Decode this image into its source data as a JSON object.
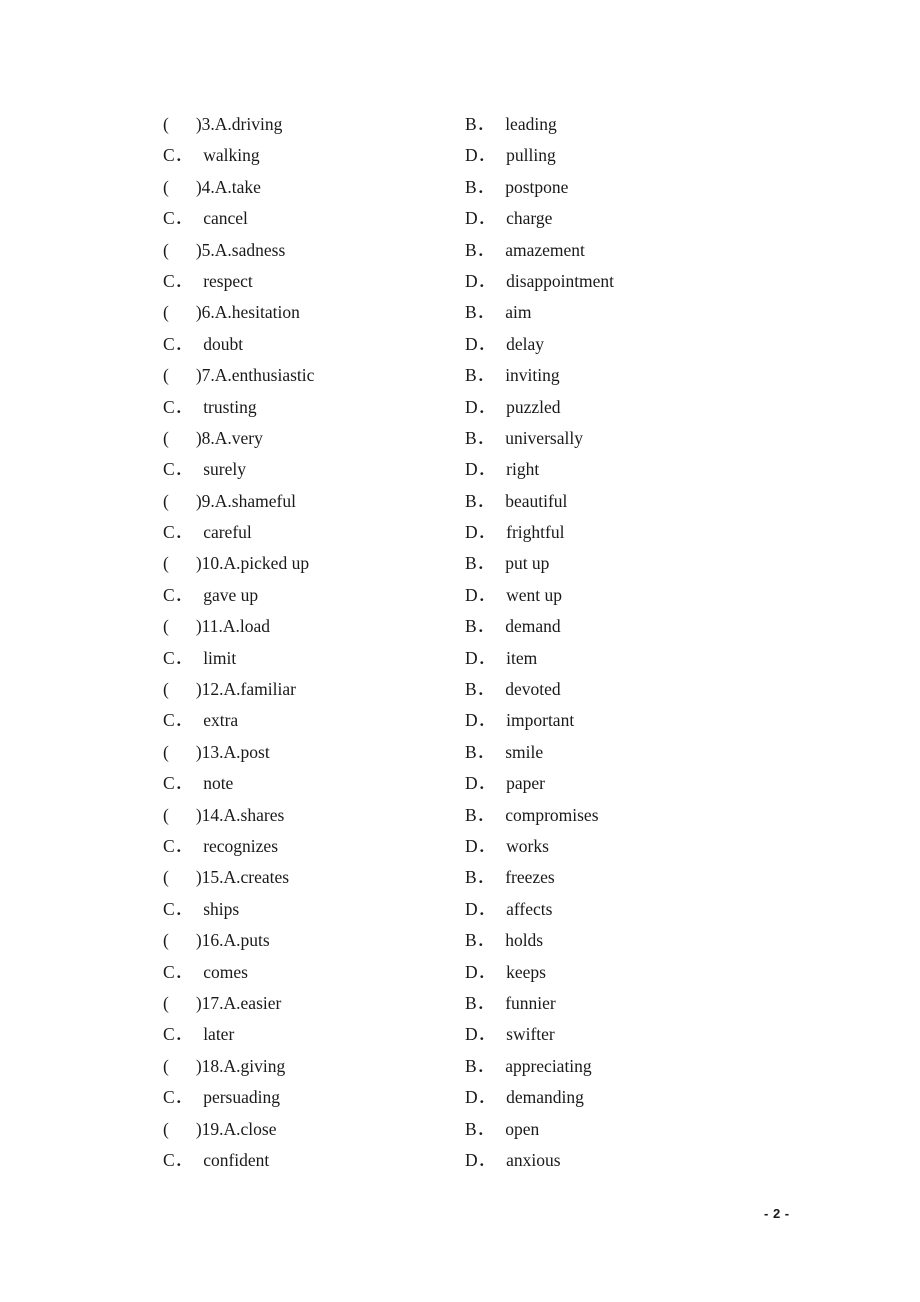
{
  "page": {
    "footer_label": "- 2 -",
    "page_number": "2",
    "background_color": "#ffffff",
    "text_color": "#1a1a1a"
  },
  "labels": {
    "open_paren": "(",
    "close_paren": ")",
    "label_b": "B．",
    "label_c": "C．",
    "label_d": "D．"
  },
  "questions": [
    {
      "number": "3",
      "stem": ")3.A.driving",
      "a": "driving",
      "b": "leading",
      "c": "walking",
      "d": "pulling"
    },
    {
      "number": "4",
      "stem": ")4.A.take",
      "a": "take",
      "b": "postpone",
      "c": "cancel",
      "d": "charge"
    },
    {
      "number": "5",
      "stem": ")5.A.sadness",
      "a": "sadness",
      "b": "amazement",
      "c": "respect",
      "d": "disappointment"
    },
    {
      "number": "6",
      "stem": ")6.A.hesitation",
      "a": "hesitation",
      "b": "aim",
      "c": "doubt",
      "d": "delay"
    },
    {
      "number": "7",
      "stem": ")7.A.enthusiastic",
      "a": "enthusiastic",
      "b": "inviting",
      "c": "trusting",
      "d": "puzzled"
    },
    {
      "number": "8",
      "stem": ")8.A.very",
      "a": "very",
      "b": "universally",
      "c": "surely",
      "d": "right"
    },
    {
      "number": "9",
      "stem": ")9.A.shameful",
      "a": "shameful",
      "b": "beautiful",
      "c": "careful",
      "d": "frightful"
    },
    {
      "number": "10",
      "stem": ")10.A.picked up",
      "a": "picked up",
      "b": "put up",
      "c": "gave up",
      "d": "went up"
    },
    {
      "number": "11",
      "stem": ")11.A.load",
      "a": "load",
      "b": "demand",
      "c": "limit",
      "d": "item"
    },
    {
      "number": "12",
      "stem": ")12.A.familiar",
      "a": "familiar",
      "b": "devoted",
      "c": "extra",
      "d": "important"
    },
    {
      "number": "13",
      "stem": ")13.A.post",
      "a": "post",
      "b": "smile",
      "c": "note",
      "d": "paper"
    },
    {
      "number": "14",
      "stem": ")14.A.shares",
      "a": "shares",
      "b": "compromises",
      "c": "recognizes",
      "d": "works"
    },
    {
      "number": "15",
      "stem": ")15.A.creates",
      "a": "creates",
      "b": "freezes",
      "c": "ships",
      "d": "affects"
    },
    {
      "number": "16",
      "stem": ")16.A.puts",
      "a": "puts",
      "b": "holds",
      "c": "comes",
      "d": "keeps"
    },
    {
      "number": "17",
      "stem": ")17.A.easier",
      "a": "easier",
      "b": "funnier",
      "c": "later",
      "d": "swifter"
    },
    {
      "number": "18",
      "stem": ")18.A.giving",
      "a": "giving",
      "b": "appreciating",
      "c": "persuading",
      "d": "demanding"
    },
    {
      "number": "19",
      "stem": ")19.A.close",
      "a": "close",
      "b": "open",
      "c": "confident",
      "d": "anxious"
    }
  ]
}
